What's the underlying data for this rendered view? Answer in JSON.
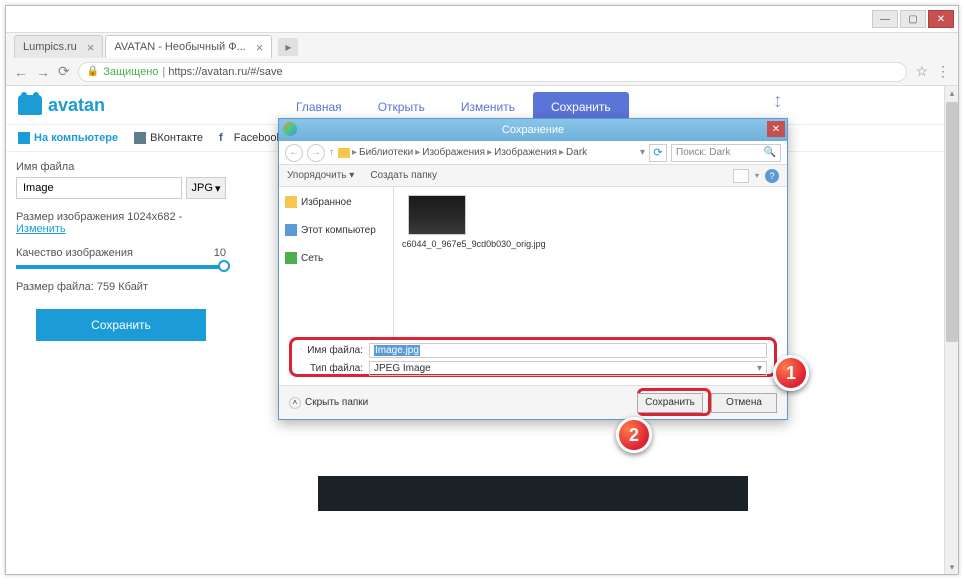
{
  "browser": {
    "tabs": [
      {
        "title": "Lumpics.ru"
      },
      {
        "title": "AVATAN - Необычный Ф..."
      }
    ],
    "secure_label": "Защищено",
    "url": "https://avatan.ru/#/save"
  },
  "page_header": {
    "logo_text": "avatan",
    "nav": {
      "main": "Главная",
      "open": "Открыть",
      "edit": "Изменить",
      "save": "Сохранить"
    },
    "social": {
      "computer": "На компьютере",
      "vk": "ВКонтакте",
      "fb": "Facebook"
    }
  },
  "sidebar": {
    "filename_label": "Имя файла",
    "filename_value": "Image",
    "format": "JPG",
    "size_label": "Размер изображения 1024x682 -",
    "size_link": "Изменить",
    "quality_label": "Качество изображения",
    "quality_value": "10",
    "filesize_label": "Размер файла:  759 Кбайт",
    "save_button": "Сохранить"
  },
  "dialog": {
    "title": "Сохранение",
    "breadcrumb": [
      "Библиотеки",
      "Изображения",
      "Изображения",
      "Dark"
    ],
    "search_placeholder": "Поиск: Dark",
    "organize": "Упорядочить",
    "new_folder": "Создать папку",
    "side": {
      "favorites": "Избранное",
      "this_pc": "Этот компьютер",
      "network": "Сеть"
    },
    "file_item": "c6044_0_967e5_9cd0b030_orig.jpg",
    "filename_label": "Имя файла:",
    "filename_value": "Image.jpg",
    "filetype_label": "Тип файла:",
    "filetype_value": "JPEG Image",
    "hide_folders": "Скрыть папки",
    "save": "Сохранить",
    "cancel": "Отмена"
  },
  "badges": {
    "one": "1",
    "two": "2"
  }
}
